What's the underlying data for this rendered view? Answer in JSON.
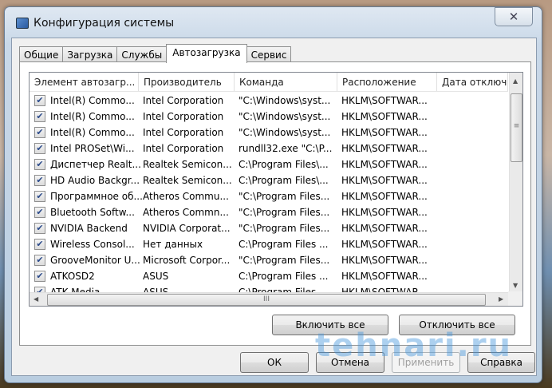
{
  "window": {
    "title": "Конфигурация системы",
    "close_glyph": "✕"
  },
  "tabs": [
    {
      "label": "Общие"
    },
    {
      "label": "Загрузка"
    },
    {
      "label": "Службы"
    },
    {
      "label": "Автозагрузка",
      "active": true
    },
    {
      "label": "Сервис"
    }
  ],
  "columns": [
    "Элемент автозагр...",
    "Производитель",
    "Команда",
    "Расположение",
    "Дата отключе"
  ],
  "rows": [
    [
      "Intel(R) Commo...",
      "Intel Corporation",
      "\"C:\\Windows\\syst...",
      "HKLM\\SOFTWAR..."
    ],
    [
      "Intel(R) Commo...",
      "Intel Corporation",
      "\"C:\\Windows\\syst...",
      "HKLM\\SOFTWAR..."
    ],
    [
      "Intel(R) Commo...",
      "Intel Corporation",
      "\"C:\\Windows\\syst...",
      "HKLM\\SOFTWAR..."
    ],
    [
      "Intel PROSet\\Wi...",
      "Intel Corporation",
      "rundll32.exe \"C:\\P...",
      "HKLM\\SOFTWAR..."
    ],
    [
      "Диспетчер Realt...",
      "Realtek Semicon...",
      "C:\\Program Files\\...",
      "HKLM\\SOFTWAR..."
    ],
    [
      "HD Audio Backgr...",
      "Realtek Semicon...",
      "C:\\Program Files\\...",
      "HKLM\\SOFTWAR..."
    ],
    [
      "Программное об...",
      "Atheros Commu...",
      "\"C:\\Program Files...",
      "HKLM\\SOFTWAR..."
    ],
    [
      "Bluetooth Softw...",
      "Atheros Commn...",
      "\"C:\\Program Files...",
      "HKLM\\SOFTWAR..."
    ],
    [
      "NVIDIA Backend",
      "NVIDIA Corporat...",
      "\"C:\\Program Files...",
      "HKLM\\SOFTWAR..."
    ],
    [
      "Wireless Consol...",
      "Нет данных",
      "C:\\Program Files ...",
      "HKLM\\SOFTWAR..."
    ],
    [
      "GrooveMonitor U...",
      "Microsoft Corpor...",
      "\"C:\\Program Files...",
      "HKLM\\SOFTWAR..."
    ],
    [
      "ATKOSD2",
      "ASUS",
      "C:\\Program Files ...",
      "HKLM\\SOFTWAR..."
    ],
    [
      "ATK Media",
      "ASUS",
      "C:\\Program Files ...",
      "HKLM\\SOFTWAR..."
    ]
  ],
  "check_glyph": "✔",
  "scroll": {
    "grip": "≡",
    "hgrip": "III",
    "up": "▲",
    "down": "▼",
    "left": "◀",
    "right": "▶"
  },
  "buttons": {
    "enable_all": "Включить все",
    "disable_all": "Отключить все",
    "ok": "ОК",
    "cancel": "Отмена",
    "apply": "Применить",
    "help": "Справка"
  },
  "watermark": "tehnari.ru"
}
